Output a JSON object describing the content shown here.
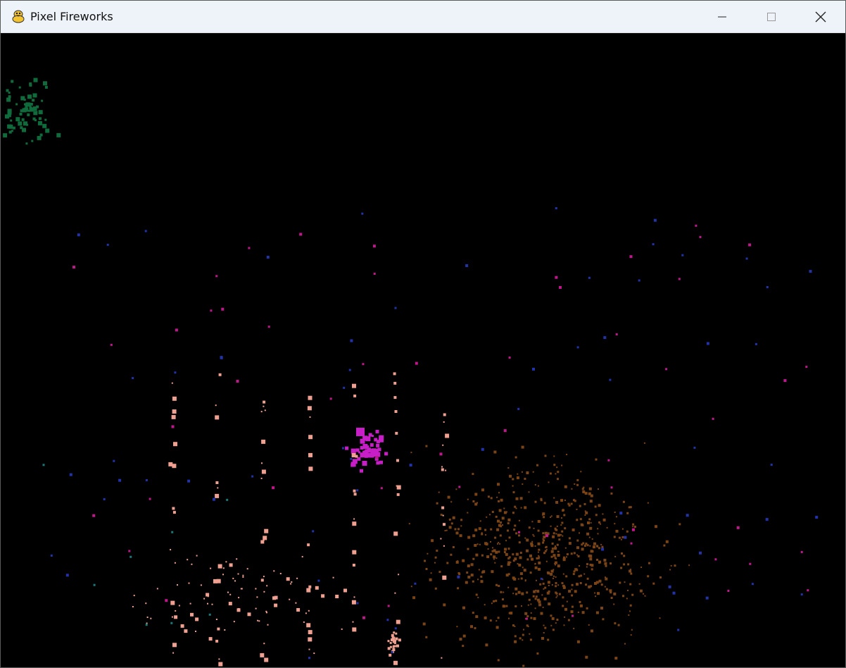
{
  "window": {
    "title": "Pixel Fireworks",
    "icon": "python-snake-icon"
  },
  "controls": {
    "minimize": "minimize-icon",
    "maximize": "maximize-icon",
    "close": "close-icon"
  },
  "colors": {
    "background": "#000000",
    "green_burst": "#0f6b3c",
    "magenta_burst": "#c81ec8",
    "salmon": "#f0a090",
    "brown": "#7a4416",
    "blue": "#2233aa",
    "pink": "#c0188c"
  }
}
